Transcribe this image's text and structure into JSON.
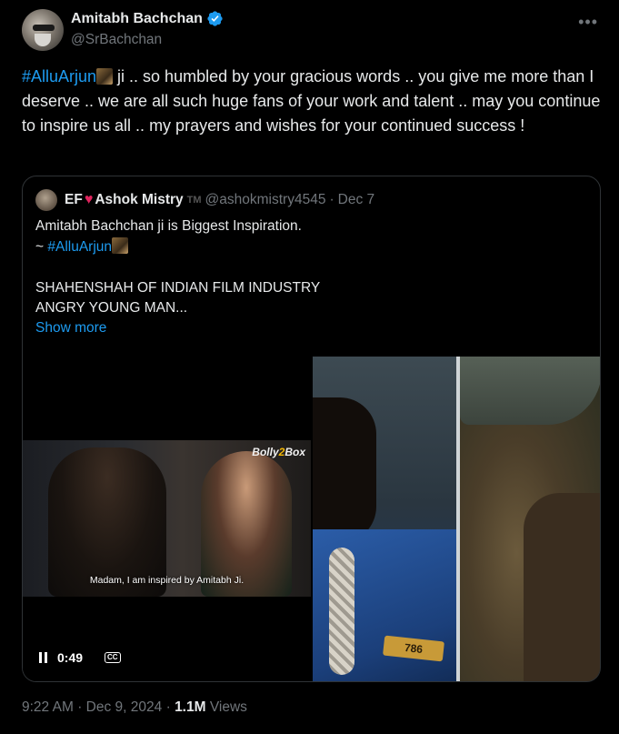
{
  "author": {
    "display_name": "Amitabh Bachchan",
    "handle": "@SrBachchan"
  },
  "tweet": {
    "hashtag": "#AlluArjun",
    "text": " ji .. so humbled by your gracious words .. you give me more than I deserve .. we are all such huge fans of your work and talent .. may you continue to inspire us all .. my prayers and wishes for your continued success !"
  },
  "quoted": {
    "name_prefix": "EF",
    "name_suffix": "Ashok Mistry",
    "tm": "TM",
    "handle": "@ashokmistry4545",
    "separator": "·",
    "date": "Dec 7",
    "line1": "Amitabh Bachchan ji is Biggest Inspiration.",
    "line2_prefix": "~ ",
    "line2_hashtag": "#AlluArjun",
    "line3": "SHAHENSHAH OF INDIAN FILM INDUSTRY",
    "line4": "ANGRY YOUNG MAN...",
    "show_more": "Show more",
    "video": {
      "watermark_a": "Bolly",
      "watermark_b": "2",
      "watermark_c": "Box",
      "subtitle": "Madam, I am inspired by Amitabh Ji.",
      "time": "0:49",
      "cc": "CC"
    },
    "photo": {
      "badge": "786"
    }
  },
  "meta": {
    "time": "9:22 AM",
    "separator": "·",
    "date": "Dec 9, 2024",
    "views_count": "1.1M",
    "views_label": "Views"
  },
  "colors": {
    "background": "#000000",
    "text_primary": "#e7e9ea",
    "text_secondary": "#71767b",
    "link": "#1d9bf0",
    "verified": "#1d9bf0",
    "heart": "#e0245e"
  },
  "icons": {
    "verified": "verified-badge-icon",
    "more": "more-options-icon",
    "heart": "heart-icon",
    "pause": "pause-icon",
    "cc": "closed-captions-icon"
  }
}
